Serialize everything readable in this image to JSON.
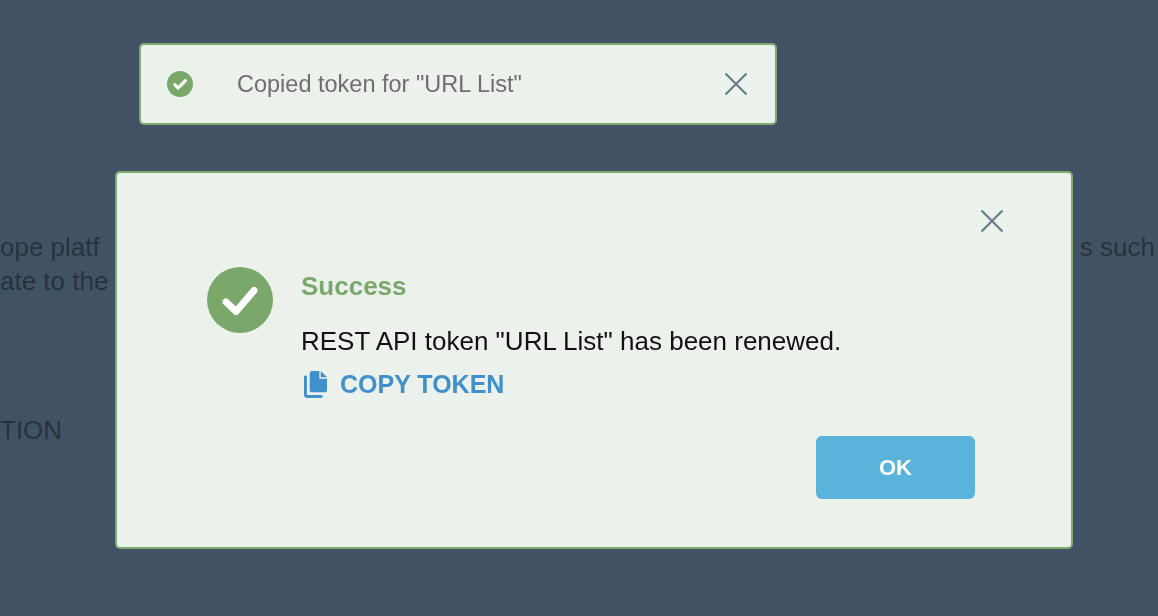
{
  "page_behind": {
    "paragraph_left": [
      "ope platf",
      "ate to the"
    ],
    "paragraph_right": [
      "s such"
    ],
    "heading": "TION"
  },
  "toast": {
    "message": "Copied token for \"URL List\""
  },
  "dialog": {
    "title": "Success",
    "message": "REST API token \"URL List\" has been renewed.",
    "link": "COPY TOKEN",
    "button": "OK"
  }
}
